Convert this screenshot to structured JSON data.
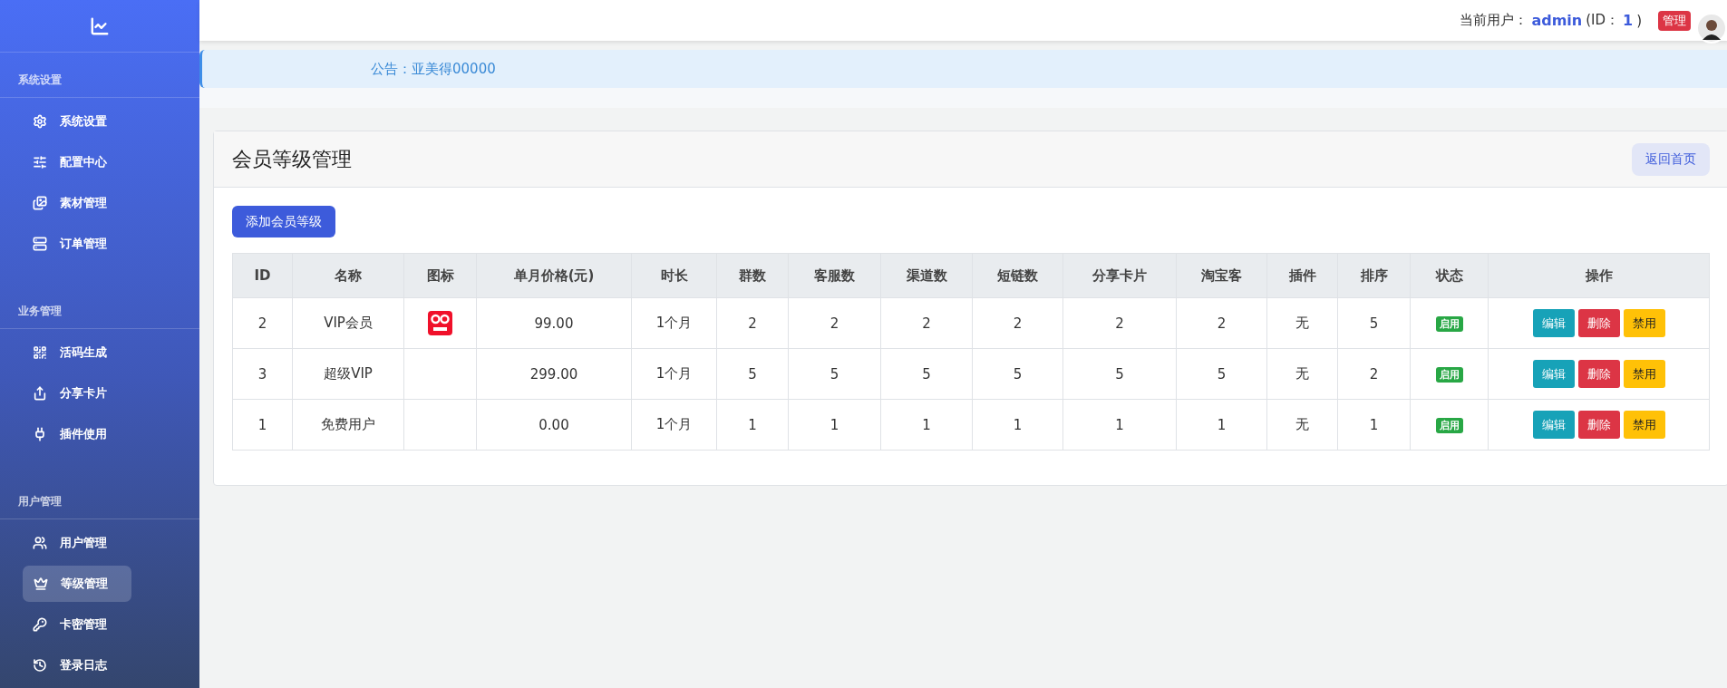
{
  "sidebar": {
    "sections": [
      {
        "title": "系统设置",
        "items": [
          {
            "label": "系统设置",
            "selected": false
          },
          {
            "label": "配置中心",
            "selected": false
          },
          {
            "label": "素材管理",
            "selected": false
          },
          {
            "label": "订单管理",
            "selected": false
          }
        ]
      },
      {
        "title": "业务管理",
        "items": [
          {
            "label": "活码生成",
            "selected": false
          },
          {
            "label": "分享卡片",
            "selected": false
          },
          {
            "label": "插件使用",
            "selected": false
          }
        ]
      },
      {
        "title": "用户管理",
        "items": [
          {
            "label": "用户管理",
            "selected": false
          },
          {
            "label": "等级管理",
            "selected": true
          },
          {
            "label": "卡密管理",
            "selected": false
          },
          {
            "label": "登录日志",
            "selected": false
          }
        ]
      }
    ]
  },
  "header": {
    "user_label": "当前用户：",
    "username": "admin",
    "id_open": "(ID：",
    "user_id": "1",
    "id_close": ")",
    "role_badge": "管理"
  },
  "notice": "公告：亚美得00000",
  "card": {
    "title": "会员等级管理",
    "back_button": "返回首页",
    "add_button": "添加会员等级"
  },
  "table": {
    "columns": [
      "ID",
      "名称",
      "图标",
      "单月价格(元)",
      "时长",
      "群数",
      "客服数",
      "渠道数",
      "短链数",
      "分享卡片",
      "淘宝客",
      "插件",
      "排序",
      "状态",
      "操作"
    ],
    "rows": [
      {
        "cells": [
          "2",
          "VIP会员",
          "",
          "99.00",
          "1个月",
          "2",
          "2",
          "2",
          "2",
          "2",
          "2",
          "无",
          "5"
        ],
        "has_icon": true,
        "status": {
          "label": "启用",
          "on": true
        },
        "actions": [
          {
            "label": "编辑",
            "kind": "edit"
          },
          {
            "label": "删除",
            "kind": "delete"
          },
          {
            "label": "禁用",
            "kind": "disable"
          }
        ]
      },
      {
        "cells": [
          "3",
          "超级VIP",
          "",
          "299.00",
          "1个月",
          "5",
          "5",
          "5",
          "5",
          "5",
          "5",
          "无",
          "2"
        ],
        "has_icon": false,
        "status": {
          "label": "启用",
          "on": true
        },
        "actions": [
          {
            "label": "编辑",
            "kind": "edit"
          },
          {
            "label": "删除",
            "kind": "delete"
          },
          {
            "label": "禁用",
            "kind": "disable"
          }
        ]
      },
      {
        "cells": [
          "1",
          "免费用户",
          "",
          "0.00",
          "1个月",
          "1",
          "1",
          "1",
          "1",
          "1",
          "1",
          "无",
          "1"
        ],
        "has_icon": false,
        "status": {
          "label": "启用",
          "on": true
        },
        "actions": [
          {
            "label": "编辑",
            "kind": "edit"
          },
          {
            "label": "删除",
            "kind": "delete"
          },
          {
            "label": "禁用",
            "kind": "disable"
          }
        ]
      }
    ]
  }
}
